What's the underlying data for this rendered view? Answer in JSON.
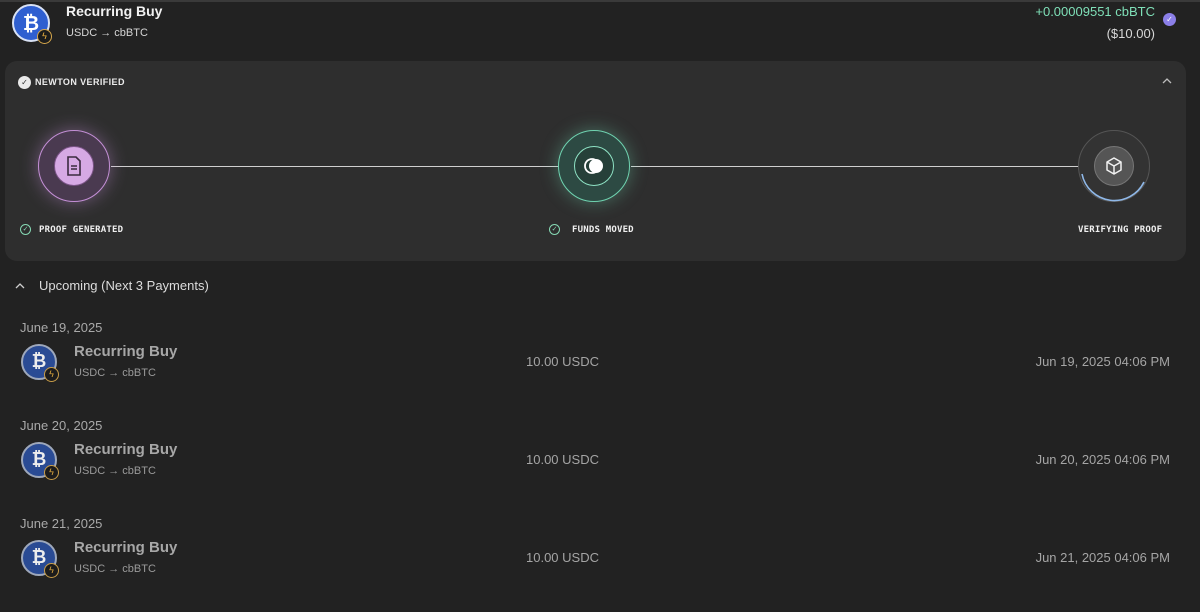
{
  "header": {
    "title": "Recurring Buy",
    "pair": "USDC → cbBTC",
    "amount": "+0.00009551 cbBTC",
    "usd": "($10.00)"
  },
  "verification": {
    "title": "NEWTON VERIFIED",
    "steps": [
      {
        "label": "PROOF GENERATED",
        "icon": "document-icon",
        "status": "done",
        "color": "#c48fd6"
      },
      {
        "label": "FUNDS MOVED",
        "icon": "coins-icon",
        "status": "done",
        "color": "#6fd3b0"
      },
      {
        "label": "VERIFYING PROOF",
        "icon": "cube-icon",
        "status": "in-progress",
        "color": "#8fb8e8"
      }
    ]
  },
  "upcoming": {
    "title": "Upcoming (Next 3 Payments)",
    "payments": [
      {
        "date": "June 19, 2025",
        "title": "Recurring Buy",
        "pair": "USDC → cbBTC",
        "amount": "10.00 USDC",
        "time": "Jun 19, 2025 04:06 PM"
      },
      {
        "date": "June 20, 2025",
        "title": "Recurring Buy",
        "pair": "USDC → cbBTC",
        "amount": "10.00 USDC",
        "time": "Jun 20, 2025 04:06 PM"
      },
      {
        "date": "June 21, 2025",
        "title": "Recurring Buy",
        "pair": "USDC → cbBTC",
        "amount": "10.00 USDC",
        "time": "Jun 21, 2025 04:06 PM"
      }
    ]
  },
  "colors": {
    "background": "#222222",
    "panel": "#2e2e2e",
    "positive": "#7fe0b8",
    "verified_badge": "#8b7fe8"
  }
}
